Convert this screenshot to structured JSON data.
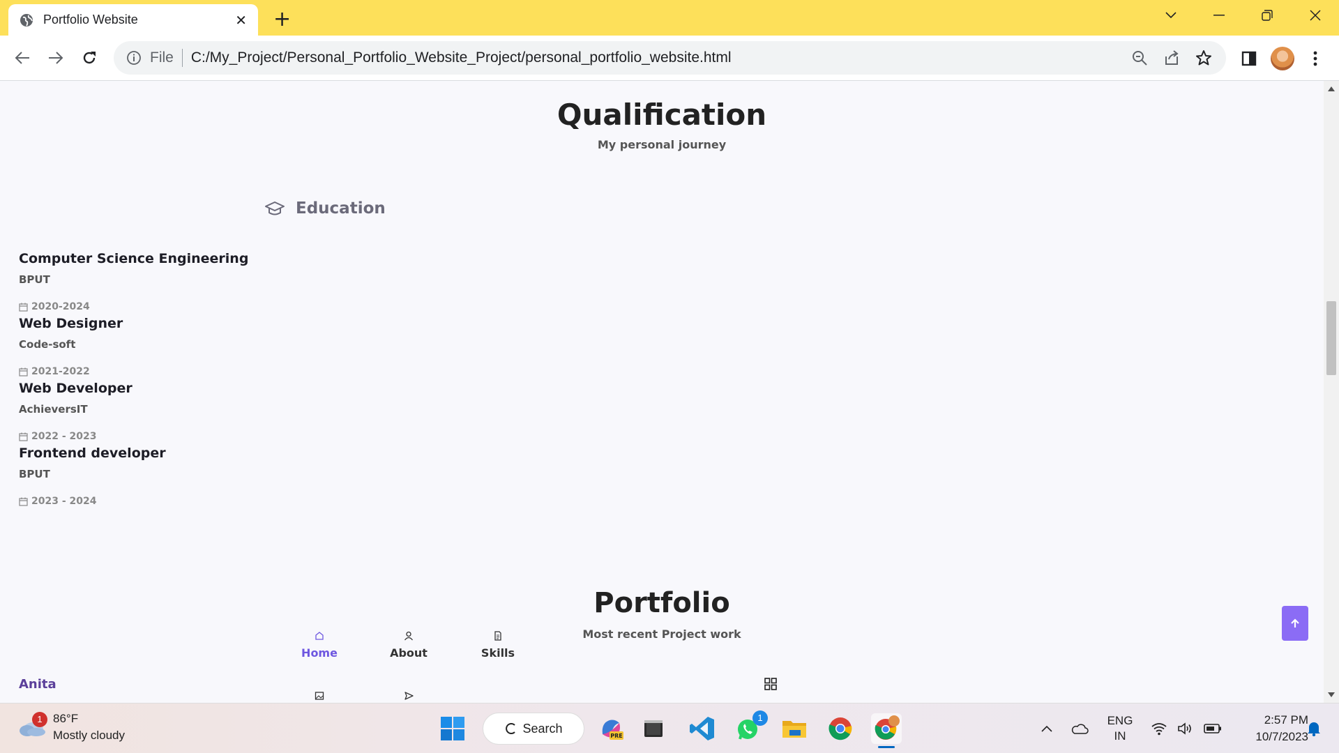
{
  "browser": {
    "tab_title": "Portfolio Website",
    "tab_close": "✕",
    "new_tab": "+",
    "scheme_label": "File",
    "url": "C:/My_Project/Personal_Portfolio_Website_Project/personal_portfolio_website.html"
  },
  "qualification": {
    "title": "Qualification",
    "subtitle": "My personal journey",
    "tab_label": "Education",
    "items": [
      {
        "title": "Computer Science Engineering",
        "subtitle": "BPUT",
        "date": "2020-2024"
      },
      {
        "title": "Web Designer",
        "subtitle": "Code-soft",
        "date": "2021-2022"
      },
      {
        "title": "Web Developer",
        "subtitle": "AchieversIT",
        "date": "2022 - 2023"
      },
      {
        "title": "Frontend developer",
        "subtitle": "BPUT",
        "date": "2023 - 2024"
      }
    ]
  },
  "portfolio": {
    "title": "Portfolio",
    "subtitle": "Most recent Project work"
  },
  "nav": {
    "brand": "Anita",
    "items": [
      {
        "label": "Home",
        "icon": "home-icon"
      },
      {
        "label": "About",
        "icon": "user-icon"
      },
      {
        "label": "Skills",
        "icon": "file-icon"
      }
    ],
    "accent": "#6e57e0"
  },
  "taskbar": {
    "weather_badge": "1",
    "temperature": "86°F",
    "condition": "Mostly cloudy",
    "search_label": "Search",
    "whatsapp_badge": "1",
    "lang_top": "ENG",
    "lang_bottom": "IN",
    "time": "2:57 PM",
    "date": "10/7/2023"
  }
}
